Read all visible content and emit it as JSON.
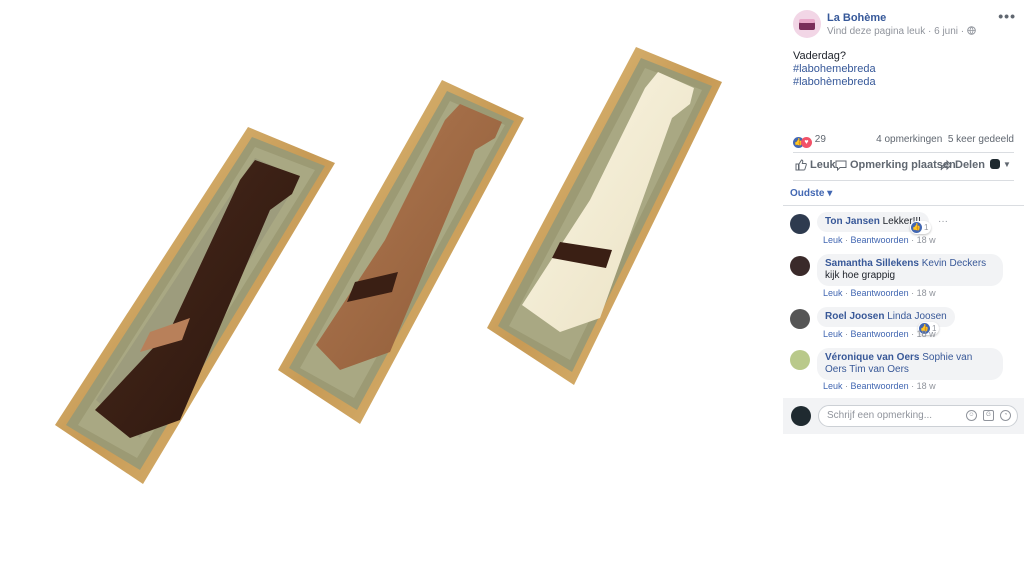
{
  "photo": {
    "alt": ""
  },
  "post": {
    "page_name": "La Bohème",
    "subtitle": "Vind deze pagina leuk · 6 juni ·",
    "more_icon": "•••",
    "text_line": "Vaderdag?",
    "hashtags": [
      "#labohemebreda",
      "#labohèmebreda"
    ]
  },
  "stats": {
    "reaction_count": "29",
    "comments_count": "4 opmerkingen",
    "shares_count": "5 keer gedeeld"
  },
  "actions": {
    "like": "Leuk",
    "comment": "Opmerking plaatsen",
    "share": "Delen"
  },
  "sort": {
    "label": "Oudste ▾"
  },
  "comments": [
    {
      "author": "Ton Jansen",
      "text": "Lekker!!!",
      "tag": "",
      "like": "Leuk",
      "reply": "Beantwoorden",
      "time": "18 w",
      "likes": "1"
    },
    {
      "author": "Samantha Sillekens",
      "tag": "Kevin Deckers",
      "text": "kijk hoe grappig",
      "like": "Leuk",
      "reply": "Beantwoorden",
      "time": "18 w",
      "likes": ""
    },
    {
      "author": "Roel Joosen",
      "tag": "Linda Joosen",
      "text": "",
      "like": "Leuk",
      "reply": "Beantwoorden",
      "time": "18 w",
      "likes": "1"
    },
    {
      "author": "Véronique van Oers",
      "tag": "Sophie van Oers Tim van Oers",
      "text": "",
      "like": "Leuk",
      "reply": "Beantwoorden",
      "time": "18 w",
      "likes": ""
    }
  ],
  "composer": {
    "placeholder": "Schrijf een opmerking..."
  },
  "colors": {
    "link": "#365899",
    "accent": "#4267b2",
    "muted": "#90949c",
    "gold": "#c9a464"
  }
}
